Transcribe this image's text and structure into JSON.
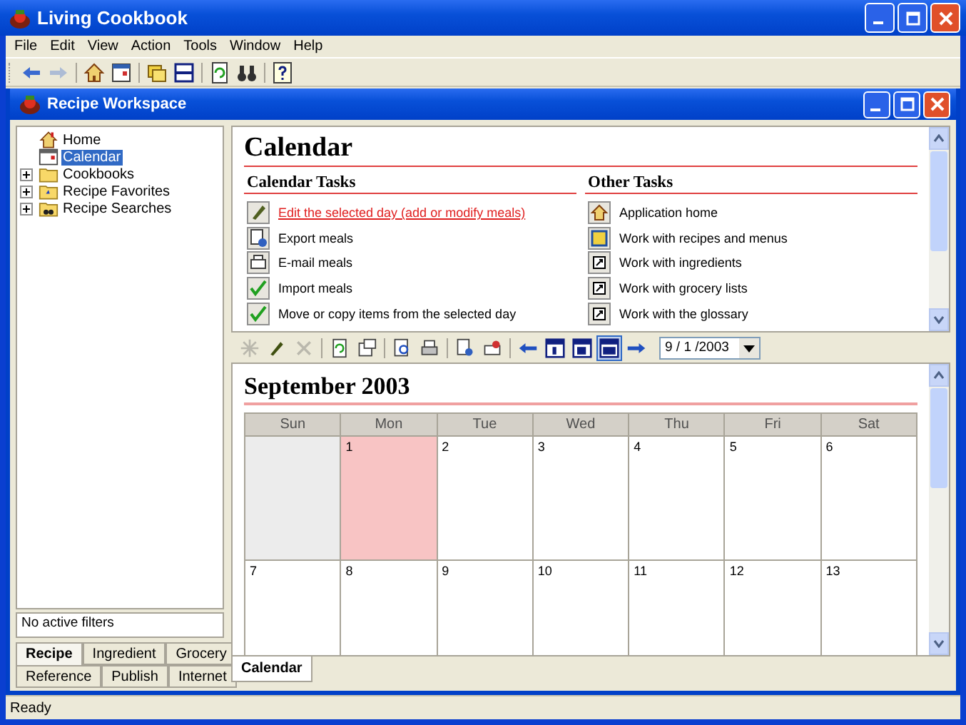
{
  "window": {
    "title": "Living Cookbook"
  },
  "menu": [
    "File",
    "Edit",
    "View",
    "Action",
    "Tools",
    "Window",
    "Help"
  ],
  "workspace": {
    "title": "Recipe Workspace"
  },
  "tree": [
    {
      "label": "Home",
      "selected": false
    },
    {
      "label": "Calendar",
      "selected": true
    },
    {
      "label": "Cookbooks",
      "selected": false,
      "expanded": false
    },
    {
      "label": "Recipe Favorites",
      "selected": false,
      "expanded": false
    },
    {
      "label": "Recipe Searches",
      "selected": false,
      "expanded": false
    }
  ],
  "filter": {
    "text": "No active filters"
  },
  "tab_rows": [
    [
      {
        "label": "Recipe",
        "selected": true
      },
      {
        "label": "Ingredient",
        "selected": false
      },
      {
        "label": "Grocery",
        "selected": false
      }
    ],
    [
      {
        "label": "Reference",
        "selected": false
      },
      {
        "label": "Publish",
        "selected": false
      },
      {
        "label": "Internet",
        "selected": false
      }
    ]
  ],
  "tasks_panel": {
    "title": "Calendar",
    "sections": [
      {
        "title": "Calendar Tasks",
        "tasks": [
          {
            "label": "Edit the selected day (add or modify meals)",
            "hovered": true
          },
          {
            "label": "Export meals",
            "hovered": false
          },
          {
            "label": "E-mail meals",
            "hovered": false
          },
          {
            "label": "Import meals",
            "hovered": false
          },
          {
            "label": "Move or copy items from the selected day",
            "hovered": false
          }
        ]
      },
      {
        "title": "Other Tasks",
        "tasks": [
          {
            "label": "Application home",
            "hovered": false
          },
          {
            "label": "Work with recipes and menus",
            "hovered": false
          },
          {
            "label": "Work with ingredients",
            "hovered": false
          },
          {
            "label": "Work with grocery lists",
            "hovered": false
          },
          {
            "label": "Work with the glossary",
            "hovered": false
          }
        ]
      }
    ]
  },
  "calendar": {
    "date": "9 / 1 /2003",
    "title": "September 2003",
    "weekdays": [
      "Sun",
      "Mon",
      "Tue",
      "Wed",
      "Thu",
      "Fri",
      "Sat"
    ],
    "weeks": [
      [
        {
          "in_month": false,
          "selected": false
        },
        {
          "label": "1",
          "in_month": true,
          "selected": true
        },
        {
          "label": "2",
          "in_month": true,
          "selected": false
        },
        {
          "label": "3",
          "in_month": true,
          "selected": false
        },
        {
          "label": "4",
          "in_month": true,
          "selected": false
        },
        {
          "label": "5",
          "in_month": true,
          "selected": false
        },
        {
          "label": "6",
          "in_month": true,
          "selected": false
        }
      ],
      [
        {
          "label": "7",
          "in_month": true,
          "selected": false
        },
        {
          "label": "8",
          "in_month": true,
          "selected": false
        },
        {
          "label": "9",
          "in_month": true,
          "selected": false
        },
        {
          "label": "10",
          "in_month": true,
          "selected": false
        },
        {
          "label": "11",
          "in_month": true,
          "selected": false
        },
        {
          "label": "12",
          "in_month": true,
          "selected": false
        },
        {
          "label": "13",
          "in_month": true,
          "selected": false
        }
      ]
    ]
  },
  "document_tabs": [
    {
      "label": "Calendar",
      "selected": true
    }
  ],
  "status_bar": {
    "text": "Ready"
  }
}
